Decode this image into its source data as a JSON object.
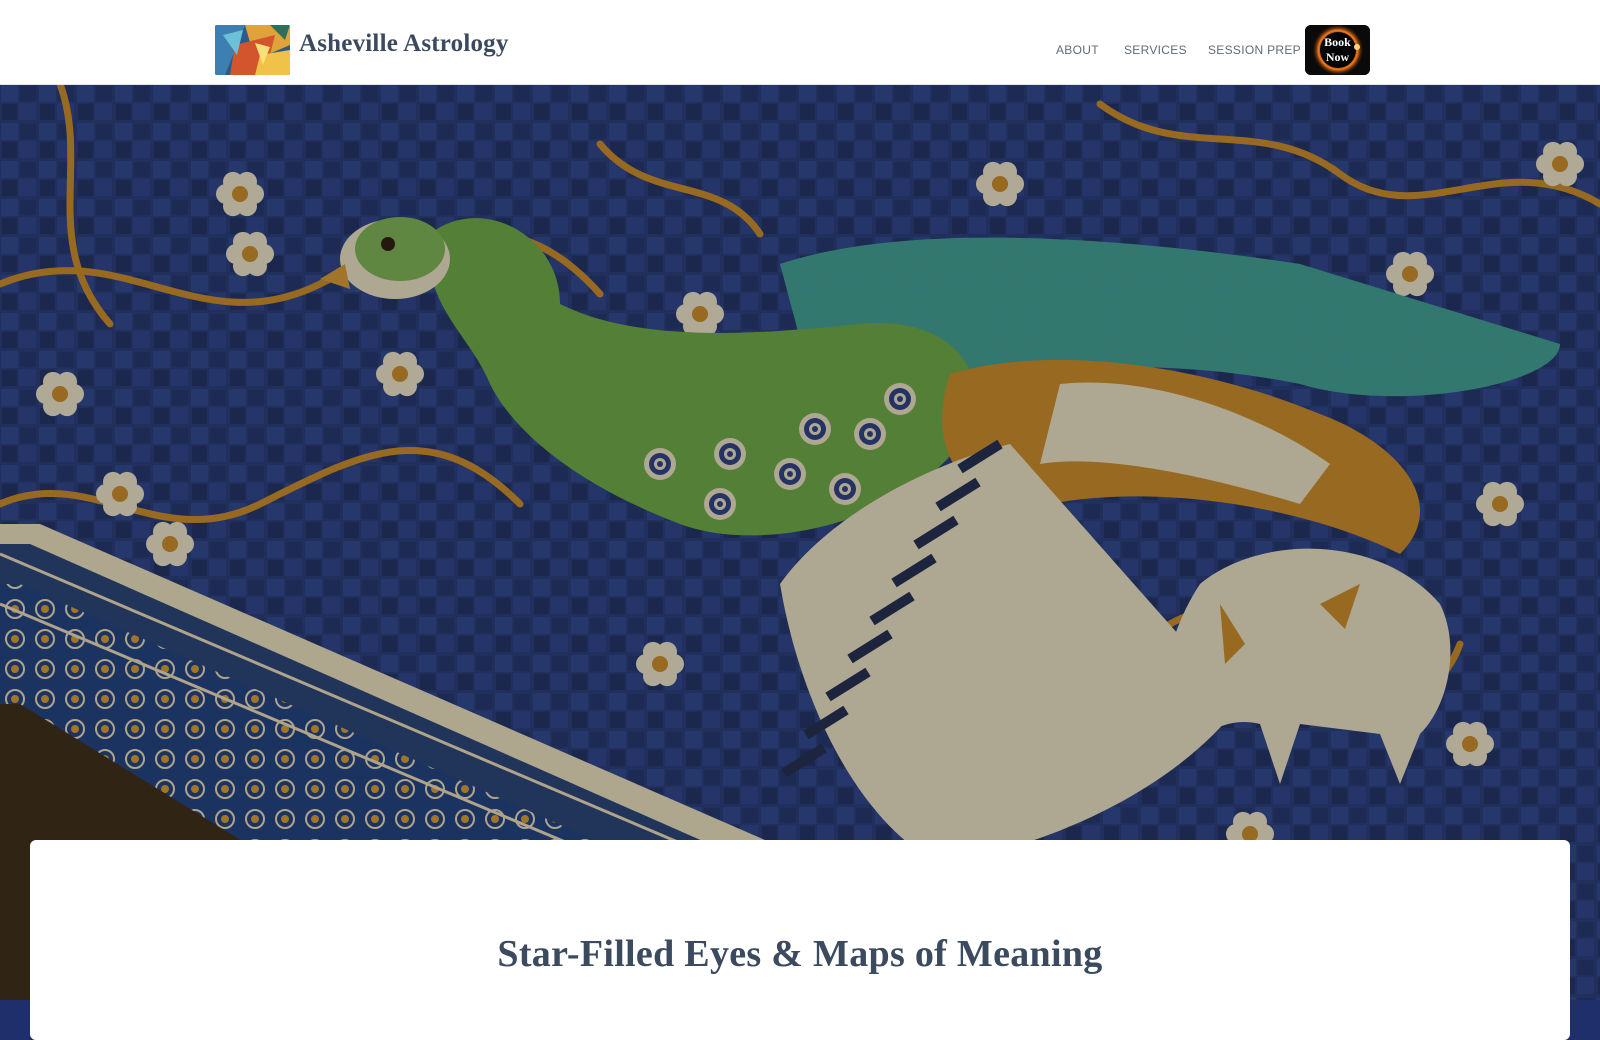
{
  "header": {
    "site_title": "Asheville Astrology",
    "nav": [
      {
        "label": "ABOUT"
      },
      {
        "label": "SERVICES"
      },
      {
        "label": "SESSION PREP"
      }
    ],
    "book_button": {
      "line1": "Book",
      "line2": "Now"
    }
  },
  "main": {
    "heading": "Star-Filled Eyes & Maps of Meaning"
  },
  "colors": {
    "header_bg": "#ffffff",
    "title_text": "#3b4a5e",
    "nav_text": "#5f6b7a",
    "mosaic_blue": "#1f2f6b",
    "mosaic_gold": "#c98a2b",
    "mosaic_teal": "#3fa39a",
    "mosaic_green": "#5c9a3a"
  }
}
